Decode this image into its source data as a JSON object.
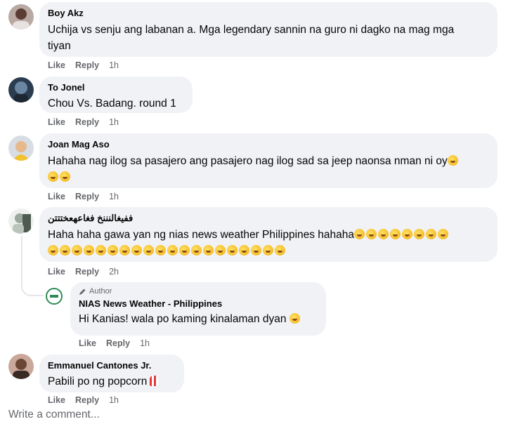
{
  "comments": [
    {
      "name": "Boy Akz",
      "text_line1": "Uchija vs senju ang labanan a. Mga legendary sannin na guro ni dagko na mag mga",
      "text_line2": "tiyan",
      "like": "Like",
      "reply": "Reply",
      "time": "1h"
    },
    {
      "name": "To Jonel",
      "text_line1": "Chou Vs. Badang. round 1",
      "like": "Like",
      "reply": "Reply",
      "time": "1h"
    },
    {
      "name": "Joan Mag Aso",
      "text_line1": "Hahaha nag ilog sa pasajero ang pasajero nag ilog sad sa jeep naonsa nman ni oy",
      "like": "Like",
      "reply": "Reply",
      "time": "1h"
    },
    {
      "name": "ففيغالنننخ فغاعهعختتتن",
      "text_line1": "Haha haha gawa yan ng nias news weather Philippines hahaha",
      "like": "Like",
      "reply": "Reply",
      "time": "2h"
    },
    {
      "author_badge": "Author",
      "name": "NIAS News Weather - Philippines",
      "text_line1": "Hi Kanias! wala po kaming kinalaman dyan",
      "like": "Like",
      "reply": "Reply",
      "time": "1h"
    },
    {
      "name": "Emmanuel Cantones Jr.",
      "text_line1": "Pabili po ng popcorn",
      "like": "Like",
      "reply": "Reply",
      "time": "1h"
    }
  ],
  "composer": {
    "placeholder": "Write a comment..."
  },
  "colors": {
    "bubble": "#f0f2f5",
    "secondary_text": "#65676b"
  },
  "icons": {
    "laugh": "rolling-on-floor-laughing-emoji",
    "popcorn": "popcorn-emoji",
    "author": "pencil-icon"
  }
}
